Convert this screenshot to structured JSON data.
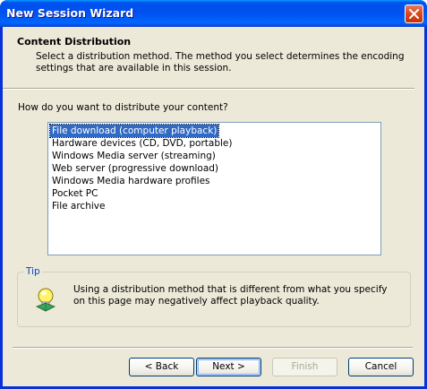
{
  "window": {
    "title": "New Session Wizard"
  },
  "header": {
    "title": "Content Distribution",
    "description": "Select a distribution method. The method you select determines the encoding settings that are available in this session."
  },
  "question": "How do you want to distribute your content?",
  "distribution_methods": {
    "selected": "File download (computer playback)",
    "items": [
      "File download (computer playback)",
      "Hardware devices (CD, DVD, portable)",
      "Windows Media server (streaming)",
      "Web server (progressive download)",
      "Windows Media hardware profiles",
      "Pocket PC",
      "File archive"
    ]
  },
  "tip": {
    "legend": "Tip",
    "icon": "tip-lightbulb-icon",
    "text": "Using a distribution method that is different from what you specify on this page may negatively affect playback quality."
  },
  "buttons": {
    "back": "< Back",
    "next": "Next >",
    "finish": "Finish",
    "cancel": "Cancel"
  },
  "colors": {
    "titlebar": "#0054e3",
    "selection": "#316ac5",
    "tip_legend": "#0046d5",
    "close_button": "#d9461b"
  }
}
